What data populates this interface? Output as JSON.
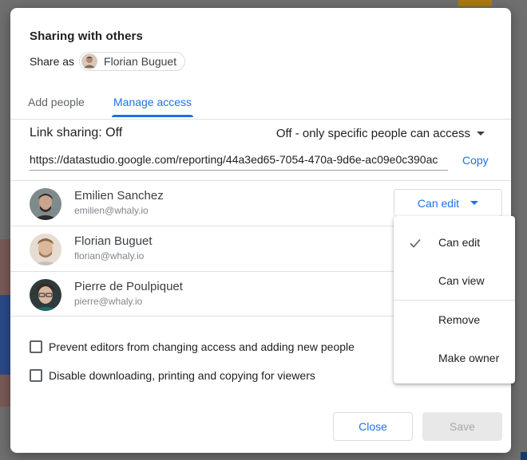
{
  "dialog": {
    "title": "Sharing with others",
    "share_as_label": "Share as",
    "share_as_user": "Florian Buguet"
  },
  "tabs": [
    {
      "label": "Add people",
      "active": false
    },
    {
      "label": "Manage access",
      "active": true
    }
  ],
  "link_sharing": {
    "label": "Link sharing: Off",
    "mode": "Off - only specific people can access",
    "url": "https://datastudio.google.com/reporting/44a3ed65-7054-470a-9d6e-ac09e0c390ac",
    "copy_label": "Copy"
  },
  "people": [
    {
      "name": "Emilien Sanchez",
      "email": "emilien@whaly.io",
      "role": "Can edit"
    },
    {
      "name": "Florian Buguet",
      "email": "florian@whaly.io"
    },
    {
      "name": "Pierre de Poulpiquet",
      "email": "pierre@whaly.io"
    }
  ],
  "options": [
    {
      "label": "Prevent editors from changing access and adding new people",
      "checked": false
    },
    {
      "label": "Disable downloading, printing and copying for viewers",
      "checked": false
    }
  ],
  "buttons": {
    "close": "Close",
    "save": "Save"
  },
  "role_menu": {
    "items": [
      {
        "label": "Can edit",
        "selected": true
      },
      {
        "label": "Can view",
        "selected": false
      },
      {
        "label": "Remove",
        "selected": false
      },
      {
        "label": "Make owner",
        "selected": false
      }
    ]
  },
  "colors": {
    "accent": "#1a73e8",
    "disabled_bg": "#e8e8e8"
  }
}
